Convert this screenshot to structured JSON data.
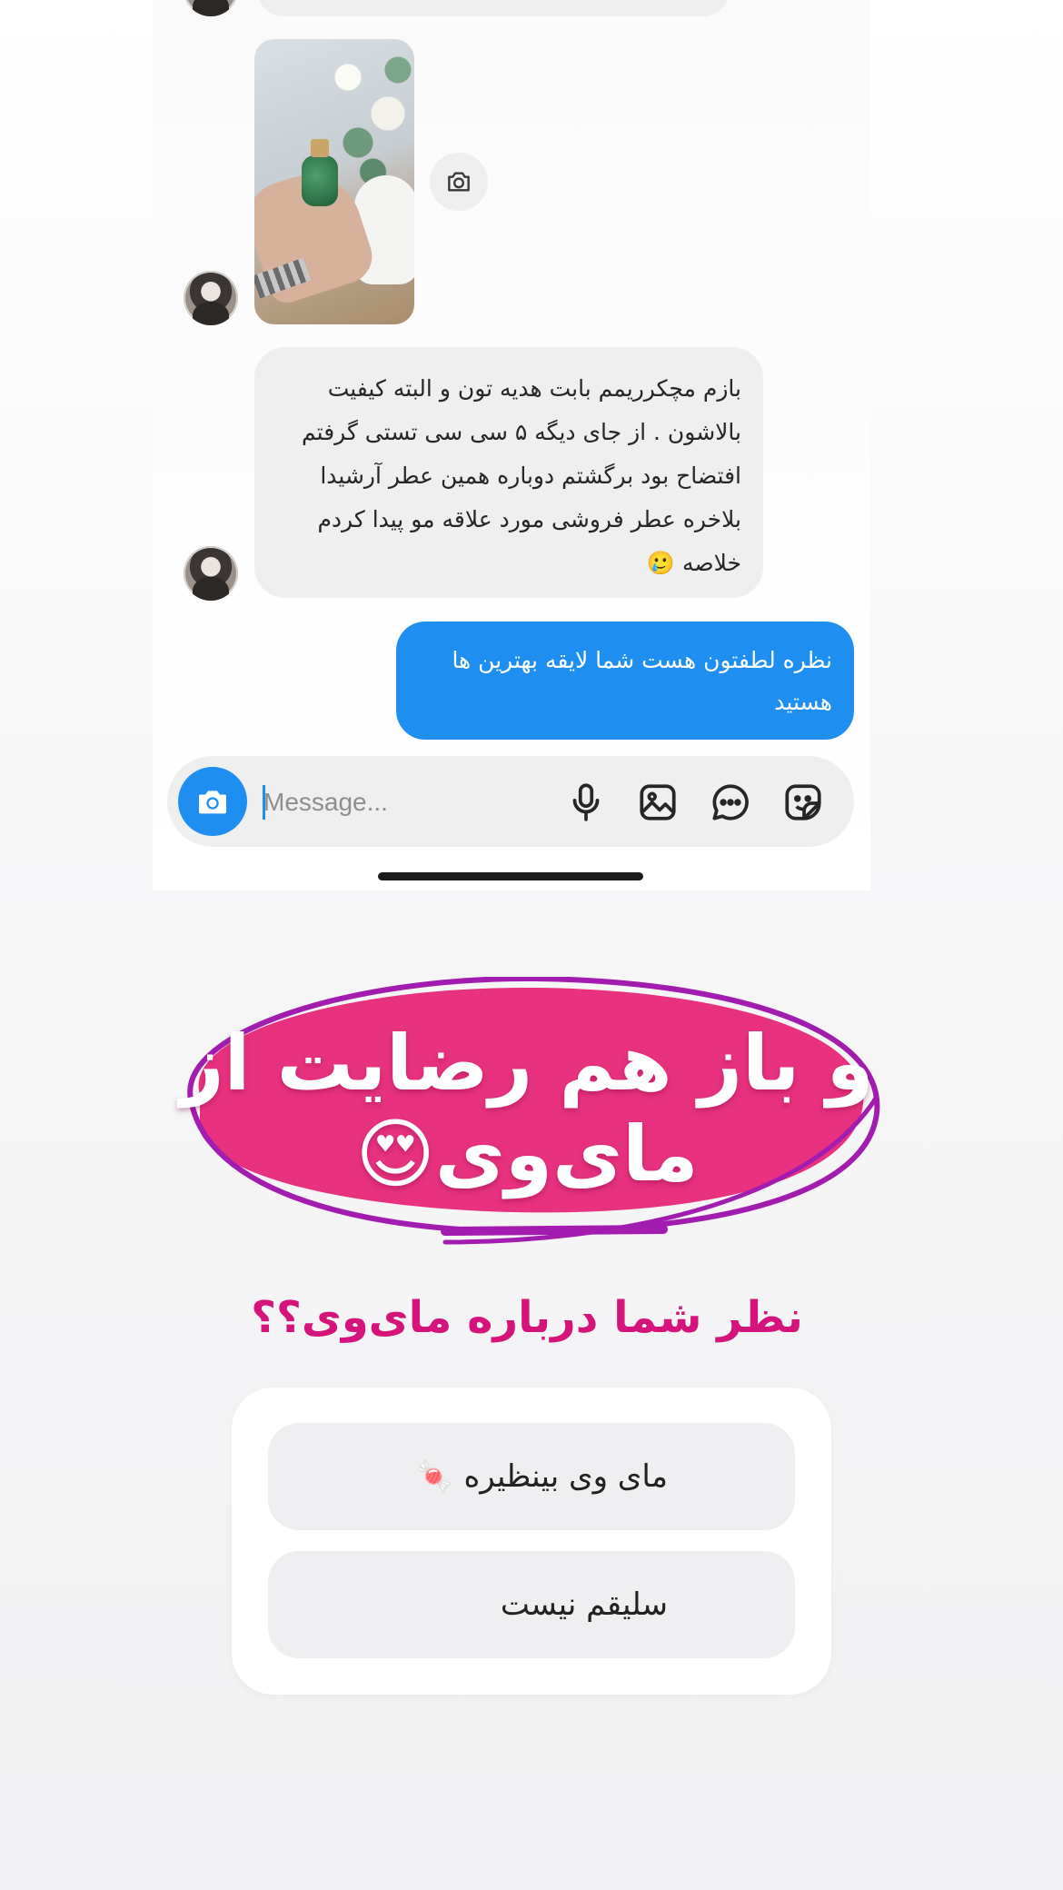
{
  "chat": {
    "incoming_message": "بازم مچکرریمم بابت هدیه تون و البته کیفیت بالاشون . از جای دیگه ۵ سی سی تستی گرفتم افتضاح بود برگشتم دوباره همین عطر آرشیدا بلاخره عطر فروشی مورد علاقه مو پیدا کردم خلاصه 🥲",
    "outgoing_message": "نظره لطفتون هست شما لایقه بهترین ها هستید"
  },
  "composer": {
    "placeholder": "Message..."
  },
  "story": {
    "headline": "و باز هم رضایت از مای‌وی😍",
    "question": "نظر شما درباره مای‌وی؟؟",
    "poll_options": [
      {
        "label": "مای وی بینظیره 🍬"
      },
      {
        "label": "سلیقم نیست"
      }
    ]
  },
  "colors": {
    "accent_blue": "#1e8ef0",
    "blob_pink": "#e8327f",
    "outline_purple": "#a21caf",
    "question_pink": "#d4147b"
  },
  "icons": [
    "camera-icon",
    "microphone-icon",
    "gallery-icon",
    "chat-bubble-icon",
    "sticker-icon"
  ]
}
